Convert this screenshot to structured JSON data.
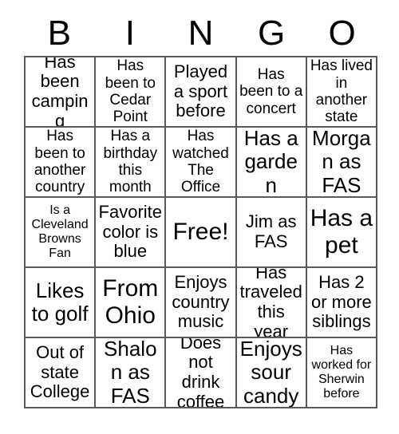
{
  "card": {
    "title": "BINGO",
    "headers": [
      "B",
      "I",
      "N",
      "G",
      "O"
    ],
    "colors": {
      "background": "#ffffff",
      "grid_line": "#5a5a5a",
      "text": "#000000"
    },
    "rows": [
      [
        {
          "text": "Has been camping",
          "size": "lg"
        },
        {
          "text": "Has been to Cedar Point",
          "size": "md"
        },
        {
          "text": "Played a sport before",
          "size": "lg"
        },
        {
          "text": "Has been to a concert",
          "size": "md"
        },
        {
          "text": "Has lived in another state",
          "size": "md"
        }
      ],
      [
        {
          "text": "Has been to another country",
          "size": "md"
        },
        {
          "text": "Has a birthday this month",
          "size": "md"
        },
        {
          "text": "Has watched The Office",
          "size": "md"
        },
        {
          "text": "Has a garden",
          "size": "xl"
        },
        {
          "text": "Morgan as FAS",
          "size": "xl"
        }
      ],
      [
        {
          "text": "Is a Cleveland Browns Fan",
          "size": "sm"
        },
        {
          "text": "Favorite color is blue",
          "size": "lg"
        },
        {
          "text": "Free!",
          "size": "xxl",
          "free": true
        },
        {
          "text": "Jim as FAS",
          "size": "lg"
        },
        {
          "text": "Has a pet",
          "size": "xxl"
        }
      ],
      [
        {
          "text": "Likes to golf",
          "size": "xl"
        },
        {
          "text": "From Ohio",
          "size": "xxl"
        },
        {
          "text": "Enjoys country music",
          "size": "lg"
        },
        {
          "text": "Has traveled this year",
          "size": "lg"
        },
        {
          "text": "Has 2 or more siblings",
          "size": "lg"
        }
      ],
      [
        {
          "text": "Out of state College",
          "size": "lg"
        },
        {
          "text": "Shalon as FAS",
          "size": "xl"
        },
        {
          "text": "Does not drink coffee",
          "size": "lg"
        },
        {
          "text": "Enjoys sour candy",
          "size": "xl"
        },
        {
          "text": "Has worked for Sherwin before",
          "size": "sm"
        }
      ]
    ]
  }
}
